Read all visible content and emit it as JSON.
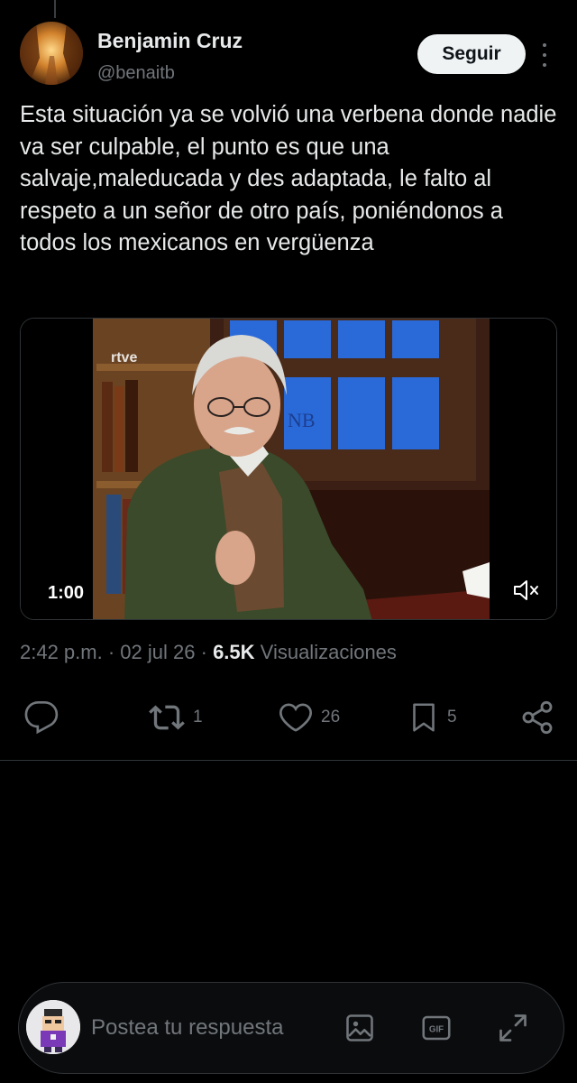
{
  "author": {
    "name": "Benjamin Cruz",
    "handle": "@benaitb",
    "follow_label": "Seguir"
  },
  "tweet": {
    "text": "Esta situación ya se volvió una verbena donde nadie va ser culpable, el punto es que una salvaje,maleducada y des adaptada, le falto al respeto a un señor de otro país, poniéndonos a todos los mexicanos en vergüenza"
  },
  "video": {
    "watermark": "rtve",
    "logo_text": "NB",
    "duration": "1:00",
    "muted": true
  },
  "meta": {
    "time": "2:42 p.m.",
    "separator": "·",
    "date": "02 jul 26",
    "views_count": "6.5K",
    "views_label": "Visualizaciones"
  },
  "actions": {
    "reply_count": "",
    "retweet_count": "1",
    "like_count": "26",
    "bookmark_count": "5"
  },
  "reply": {
    "placeholder": "Postea tu respuesta",
    "gif_label": "GIF"
  },
  "colors": {
    "background": "#000000",
    "text_primary": "#e7e9ea",
    "text_secondary": "#71767b",
    "border": "#2f3336",
    "button_bg": "#eff3f4"
  }
}
